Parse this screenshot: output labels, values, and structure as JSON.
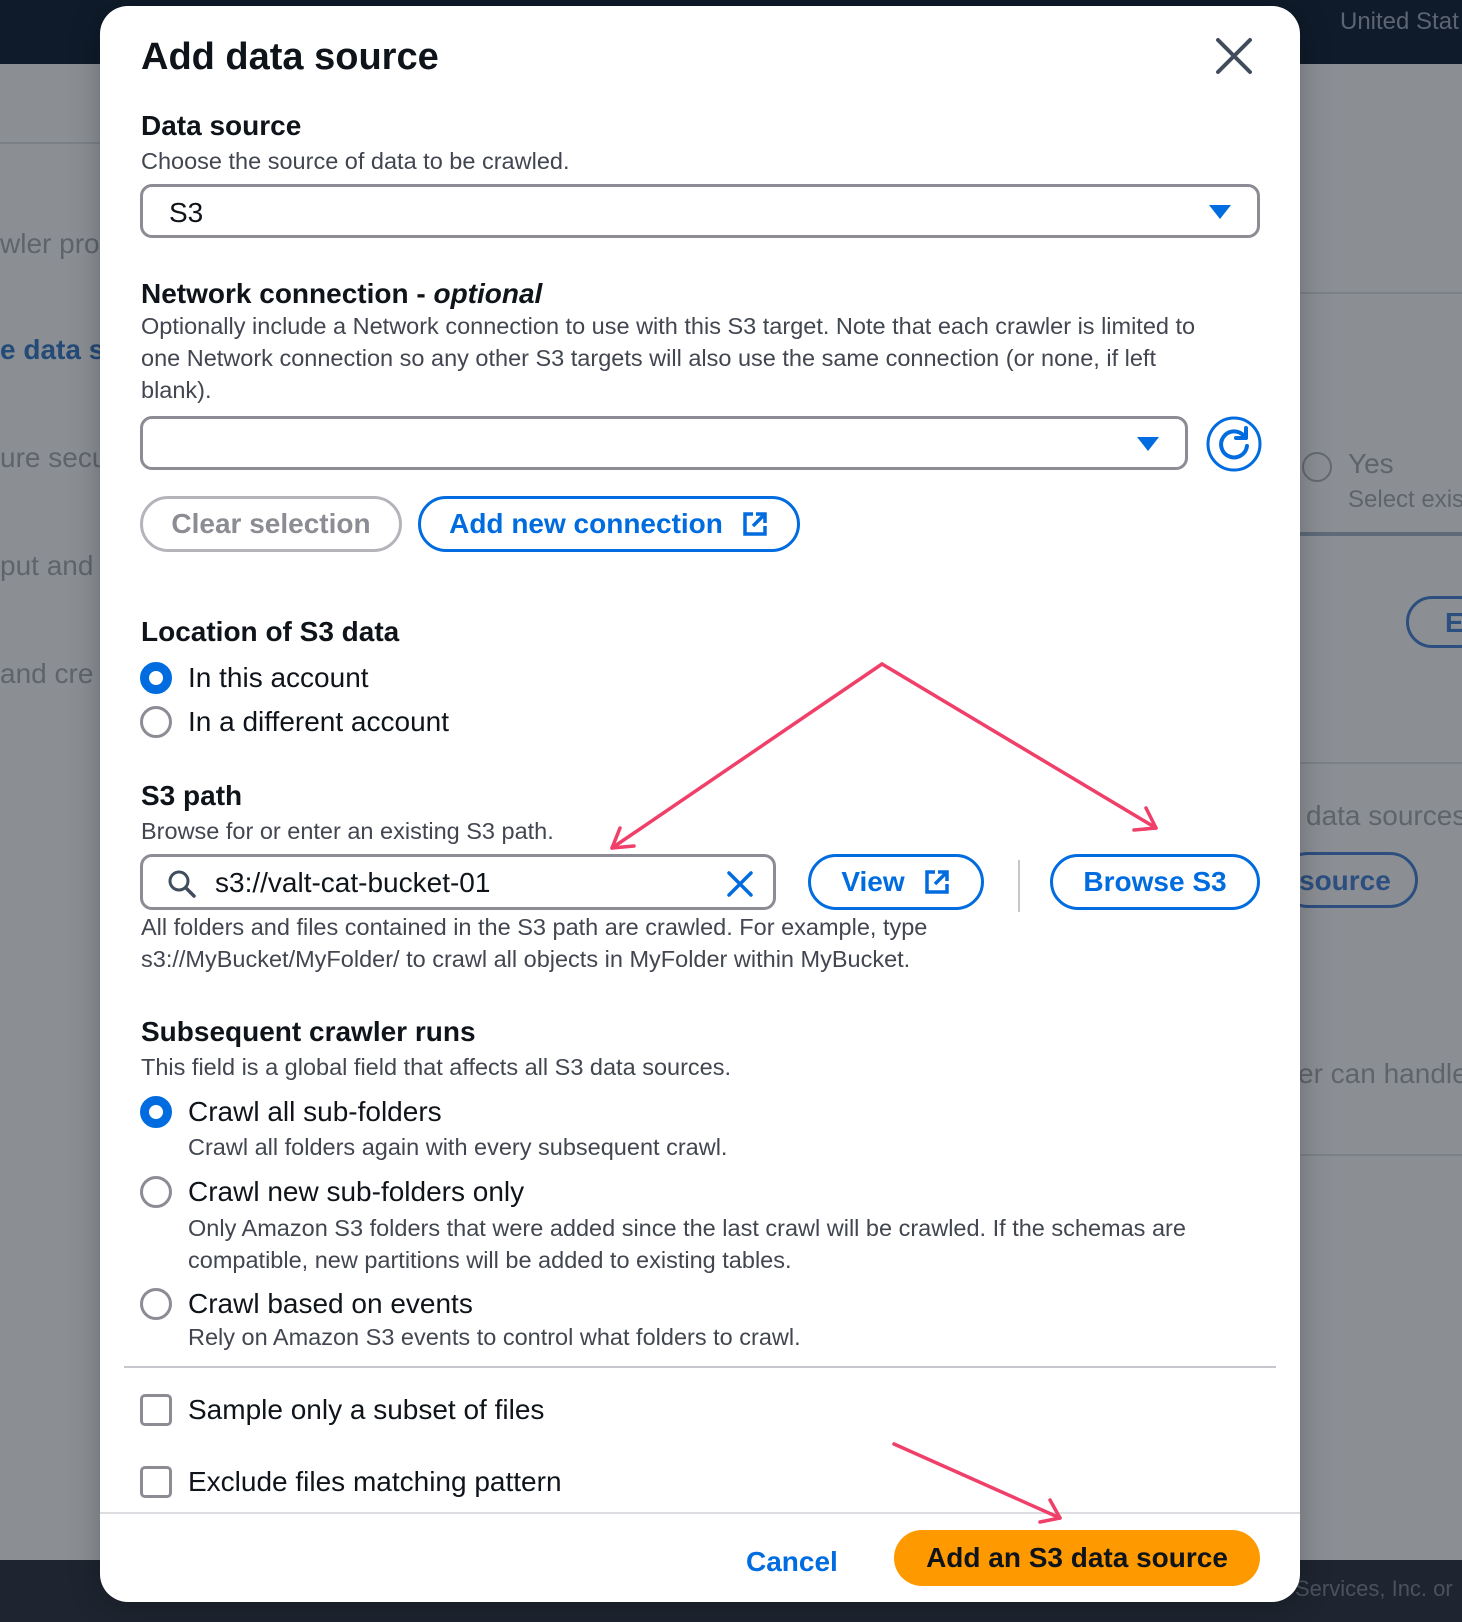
{
  "background": {
    "region": "United Stat",
    "left_snippets": [
      "wler pro",
      "e data so",
      "ure secu",
      "put and",
      "and cre"
    ],
    "right_yes": "Yes",
    "right_select": "Select exis",
    "right_btn_e": "E",
    "right_data_sources": "data sources",
    "right_source_btn": "source",
    "right_can_handle": "er can handle",
    "footer": "Services, Inc. or"
  },
  "modal": {
    "title": "Add data source",
    "data_source": {
      "label": "Data source",
      "description": "Choose the source of data to be crawled.",
      "selected": "S3"
    },
    "network": {
      "label": "Network connection - ",
      "label_suffix": "optional",
      "description": "Optionally include a Network connection to use with this S3 target. Note that each crawler is limited to one Network connection so any other S3 targets will also use the same connection (or none, if left blank).",
      "selected": "",
      "clear_button": "Clear selection",
      "add_button": "Add new connection"
    },
    "location": {
      "label": "Location of S3 data",
      "options": [
        "In this account",
        "In a different account"
      ],
      "selected_index": 0
    },
    "s3_path": {
      "label": "S3 path",
      "description": "Browse for or enter an existing S3 path.",
      "value": "s3://valt-cat-bucket-01",
      "view_button": "View",
      "browse_button": "Browse S3",
      "help_line1": "All folders and files contained in the S3 path are crawled. For example, type",
      "help_line2": "s3://MyBucket/MyFolder/ to crawl all objects in MyFolder within MyBucket."
    },
    "subsequent": {
      "label": "Subsequent crawler runs",
      "description": "This field is a global field that affects all S3 data sources.",
      "options": [
        {
          "label": "Crawl all sub-folders",
          "desc": "Crawl all folders again with every subsequent crawl."
        },
        {
          "label": "Crawl new sub-folders only",
          "desc": "Only Amazon S3 folders that were added since the last crawl will be crawled. If the schemas are compatible, new partitions will be added to existing tables."
        },
        {
          "label": "Crawl based on events",
          "desc": "Rely on Amazon S3 events to control what folders to crawl."
        }
      ],
      "selected_index": 0
    },
    "checkboxes": [
      {
        "label": "Sample only a subset of files",
        "checked": false
      },
      {
        "label": "Exclude files matching pattern",
        "checked": false
      }
    ],
    "footer": {
      "cancel": "Cancel",
      "primary": "Add an S3 data source"
    }
  },
  "colors": {
    "accent": "#006ce0",
    "primary_button": "#ff9900",
    "annotation_arrow": "#f0406a"
  }
}
